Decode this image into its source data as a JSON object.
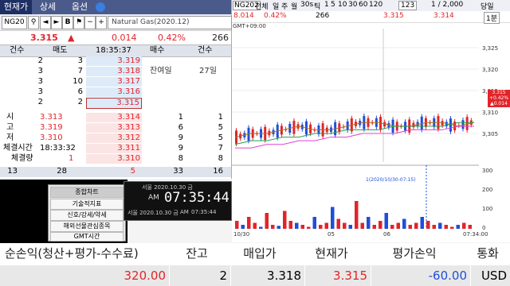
{
  "tabs": [
    "현재가",
    "상세",
    "옵션"
  ],
  "symbol": {
    "code": "NG20",
    "name": "Natural Gas(2020.12)"
  },
  "quote": {
    "price": "3.315",
    "arrow": "▲",
    "change": "0.014",
    "pct": "0.42%",
    "volume": "266"
  },
  "book_header": [
    "건수",
    "매도",
    "18:35:37",
    "매수",
    "건수"
  ],
  "asks": [
    {
      "cnt": "2",
      "qty": "3",
      "price": "3.319"
    },
    {
      "cnt": "3",
      "qty": "7",
      "price": "3.318"
    },
    {
      "cnt": "3",
      "qty": "10",
      "price": "3.317"
    },
    {
      "cnt": "3",
      "qty": "6",
      "price": "3.316"
    },
    {
      "cnt": "2",
      "qty": "2",
      "price": "3.315"
    }
  ],
  "remaining": {
    "label": "잔여일",
    "value": "27일"
  },
  "stats": [
    {
      "label": "시",
      "value": "3.313"
    },
    {
      "label": "고",
      "value": "3.319"
    },
    {
      "label": "저",
      "value": "3.310"
    },
    {
      "label": "체결시간",
      "value": "18:33:32"
    },
    {
      "label": "체결량",
      "value": "1"
    }
  ],
  "bids": [
    {
      "price": "3.314",
      "qty": "1",
      "cnt": "1"
    },
    {
      "price": "3.313",
      "qty": "6",
      "cnt": "5"
    },
    {
      "price": "3.312",
      "qty": "9",
      "cnt": "5"
    },
    {
      "price": "3.311",
      "qty": "9",
      "cnt": "7"
    },
    {
      "price": "3.310",
      "qty": "8",
      "cnt": "8"
    }
  ],
  "totals": {
    "ask_cnt": "13",
    "ask_qty": "28",
    "diff": "5",
    "bid_qty": "33",
    "bid_cnt": "16"
  },
  "menu": {
    "title": "종합차트",
    "items": [
      "기술적지표",
      "신호/강세/약세",
      "해외선물관심종목",
      "GMT시간"
    ]
  },
  "clock": {
    "date_line": "서울 2020.10.30 금",
    "ampm": "AM",
    "time": "07:35:44",
    "date_line2": "서울 2020.10.30 금",
    "ampm2": "AM",
    "time2": "07:35:44"
  },
  "chart_toolbar": {
    "code": "NG202",
    "items": [
      "전체",
      "일",
      "주",
      "월",
      "30s",
      "틱",
      "1",
      "5",
      "10",
      "30",
      "60",
      "120"
    ],
    "count": "123",
    "ratio": "1 / 2,000",
    "day_label": "당일",
    "mini_prices": [
      "8.014",
      "0.42%",
      "266",
      "3.315",
      "3.314"
    ],
    "gmt": "GMT+09:00",
    "right_label": "1분"
  },
  "chart_data": [
    {
      "type": "line",
      "title": "",
      "ylim": [
        3.305,
        3.34
      ],
      "y_ticks": [
        "3,325",
        "3,320",
        "3,315",
        "3,310",
        "3,305"
      ],
      "price_label_top": "3.315",
      "price_label_pct": "+0.42%",
      "price_label_chg": "▲0.014",
      "x_labels": [
        "10/30",
        "05",
        "06",
        "07:34:00"
      ],
      "series": [
        {
          "values": [
            3.311,
            3.312,
            3.312,
            3.313,
            3.314,
            3.313,
            3.313,
            3.314,
            3.315,
            3.315,
            3.314,
            3.314,
            3.315,
            3.315,
            3.314,
            3.315
          ]
        },
        {
          "values": [
            3.309,
            3.31,
            3.31,
            3.311,
            3.311,
            3.312,
            3.312,
            3.313,
            3.313,
            3.313,
            3.314,
            3.314,
            3.314,
            3.314,
            3.315,
            3.315
          ]
        },
        {
          "values": [
            3.308,
            3.308,
            3.309,
            3.309,
            3.31,
            3.31,
            3.311,
            3.311,
            3.312,
            3.312,
            3.312,
            3.313,
            3.313,
            3.313,
            3.314,
            3.314
          ]
        }
      ]
    },
    {
      "type": "bar",
      "title": "",
      "annotation": "1(2020/10/30-07:15)",
      "y_ticks": [
        "300",
        "200",
        "100",
        "0"
      ],
      "ylim": [
        0,
        320
      ],
      "values": [
        40,
        20,
        60,
        30,
        10,
        80,
        20,
        15,
        90,
        40,
        30,
        20,
        10,
        60,
        20,
        30,
        110,
        50,
        30,
        20,
        140,
        30,
        60,
        20,
        40,
        80,
        20,
        30,
        50,
        20,
        30,
        60,
        40,
        20,
        30,
        20,
        10,
        20,
        30,
        20
      ]
    }
  ],
  "bottom": {
    "headers": [
      "순손익(청산+평가-수수료)",
      "잔고",
      "매입가",
      "현재가",
      "평가손익",
      "통화"
    ],
    "values": [
      "320.00",
      "2",
      "3.318",
      "3.315",
      "-60.00",
      "USD"
    ]
  },
  "colors": {
    "up": "#e0252a",
    "down": "#1f4fd8",
    "ma_green": "#22a04a",
    "ma_magenta": "#e040d0",
    "ma_brown": "#b0701c"
  }
}
